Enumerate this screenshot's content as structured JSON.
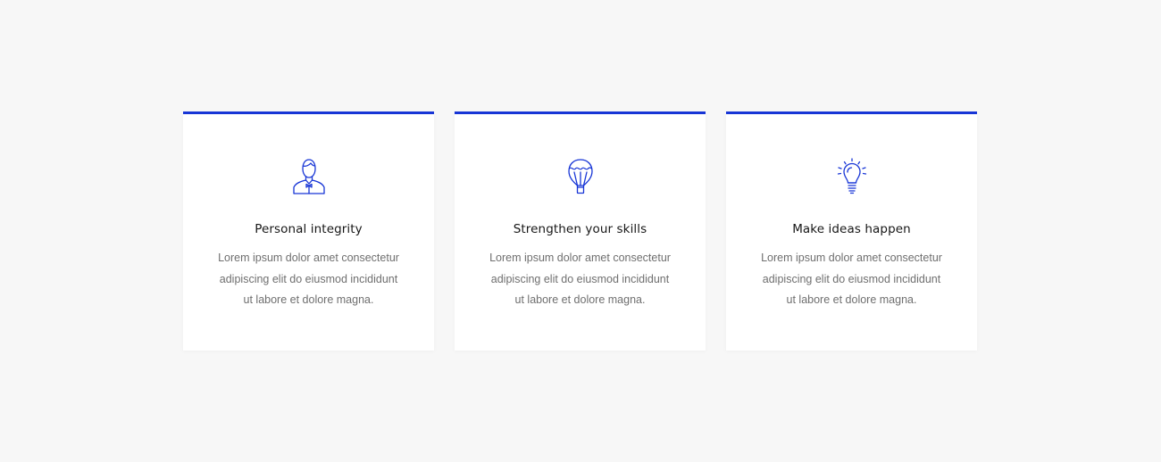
{
  "accent_color": "#1735d6",
  "cards": [
    {
      "icon": "person-icon",
      "title": "Personal integrity",
      "description": "Lorem ipsum dolor amet consectetur adipiscing elit do eiusmod incididunt ut labore et dolore magna."
    },
    {
      "icon": "hot-air-balloon-icon",
      "title": "Strengthen your skills",
      "description": "Lorem ipsum dolor amet consectetur adipiscing elit do eiusmod incididunt ut labore et dolore magna."
    },
    {
      "icon": "lightbulb-icon",
      "title": "Make ideas happen",
      "description": "Lorem ipsum dolor amet consectetur adipiscing elit do eiusmod incididunt ut labore et dolore magna."
    }
  ]
}
